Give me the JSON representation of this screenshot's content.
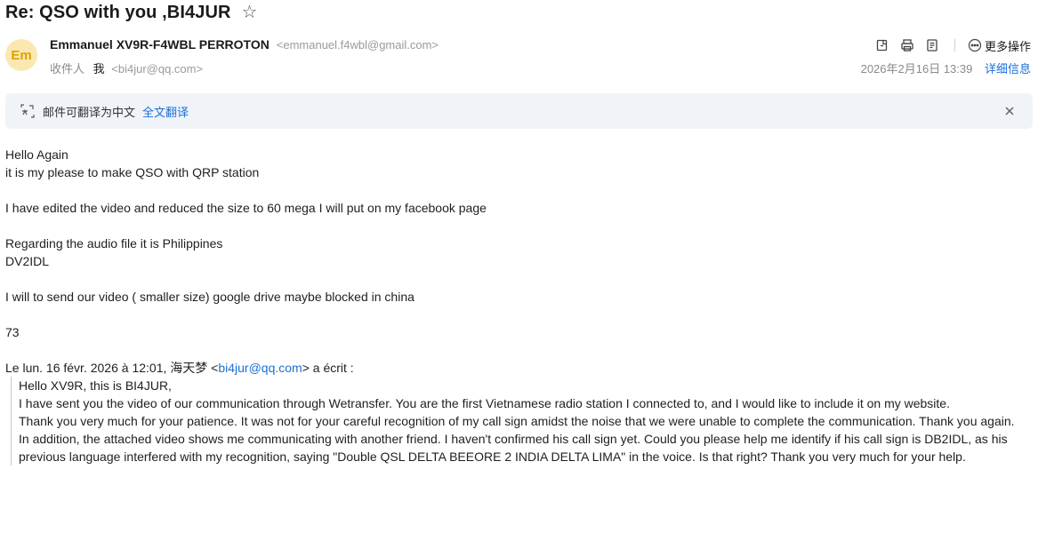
{
  "subject": "Re: QSO with you ,BI4JUR",
  "sender": {
    "avatar_text": "Em",
    "name": "Emmanuel XV9R-F4WBL PERROTON",
    "email": "<emmanuel.f4wbl@gmail.com>"
  },
  "recipient": {
    "label": "收件人",
    "name": "我",
    "email": "<bi4jur@qq.com>"
  },
  "date": "2026年2月16日 13:39",
  "actions": {
    "more_label": "更多操作",
    "details_label": "详细信息"
  },
  "translate": {
    "text": "邮件可翻译为中文",
    "link": "全文翻译"
  },
  "body": {
    "line1": "Hello Again",
    "line2": "it is my please to make QSO with QRP station",
    "line3": "I have edited the video and reduced the size to 60 mega I will put on my facebook page",
    "line4": "Regarding the audio file it is Philippines",
    "line5": "DV2IDL",
    "line6": "I will to send our video ( smaller size) google drive maybe blocked in china",
    "line7": "73",
    "quote_intro_before": "Le lun. 16 févr. 2026 à 12:01, 海天梦 <",
    "quote_intro_link": "bi4jur@qq.com",
    "quote_intro_after": "> a écrit :"
  },
  "quote": {
    "q1": "Hello XV9R, this is BI4JUR,",
    "q2": "I have sent you the video of our communication through Wetransfer. You are the first Vietnamese radio station I connected to, and I would like to include it on my website.",
    "q3": "Thank you very much for your patience. It was not for your careful recognition of my call sign amidst the noise that we were unable to complete the communication. Thank you again.",
    "q4": "In addition, the attached video shows me communicating with another friend. I haven't confirmed his call sign yet. Could you please help me identify if his call sign is DB2IDL, as his previous language interfered with my recognition, saying \"Double QSL DELTA BEEORE 2 INDIA DELTA LIMA\" in the voice. Is that right? Thank you very much for your help."
  },
  "colors": {
    "link": "#1a6fd8",
    "avatar_bg": "#fbe8b1",
    "avatar_text": "#e0a000",
    "translate_bar_bg": "#f0f4f9"
  }
}
